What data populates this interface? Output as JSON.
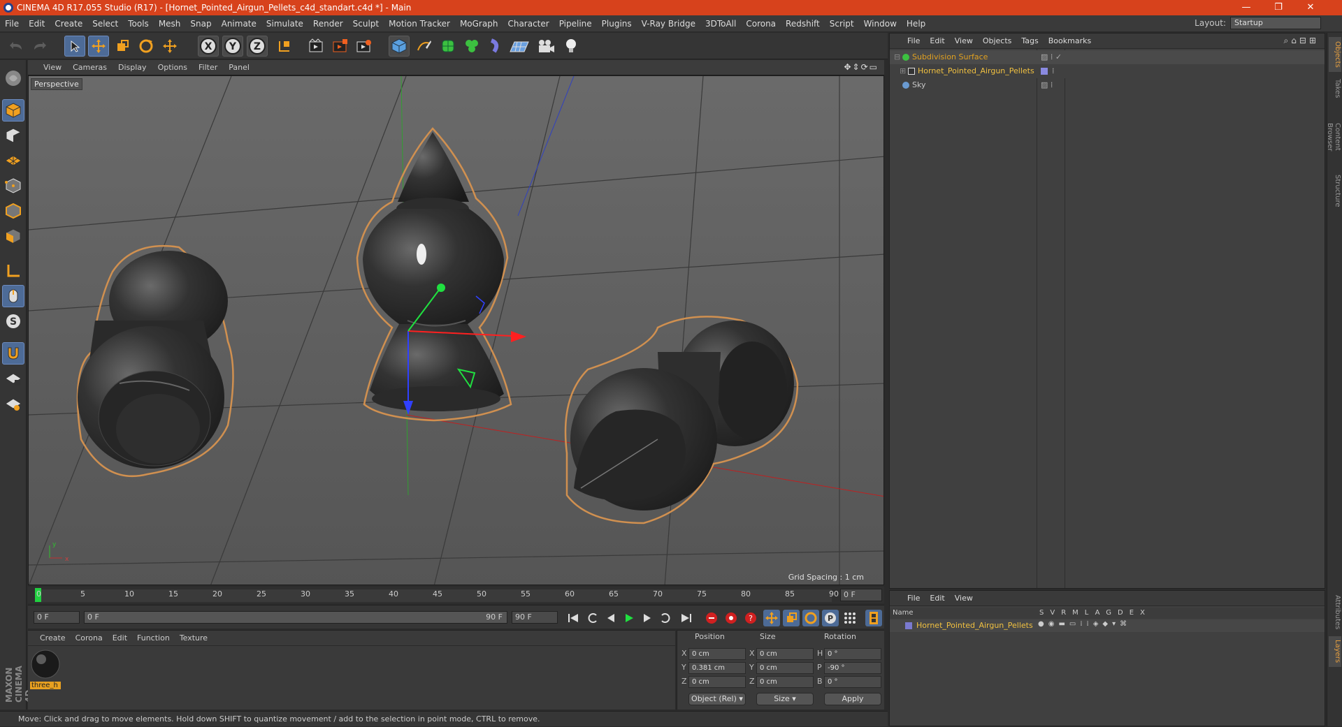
{
  "window": {
    "title": "CINEMA 4D R17.055 Studio (R17) - [Hornet_Pointed_Airgun_Pellets_c4d_standart.c4d *] - Main",
    "minimize": "—",
    "maximize": "❐",
    "close": "✕"
  },
  "menubar": {
    "items": [
      "File",
      "Edit",
      "Create",
      "Select",
      "Tools",
      "Mesh",
      "Snap",
      "Animate",
      "Simulate",
      "Render",
      "Sculpt",
      "Motion Tracker",
      "MoGraph",
      "Character",
      "Pipeline",
      "Plugins",
      "V-Ray Bridge",
      "3DToAll",
      "Corona",
      "Redshift",
      "Script",
      "Window",
      "Help"
    ],
    "layout_label": "Layout:",
    "layout_value": "Startup"
  },
  "toolbar": {
    "axis_x": "X",
    "axis_y": "Y",
    "axis_z": "Z"
  },
  "viewport": {
    "menu": [
      "View",
      "Cameras",
      "Display",
      "Options",
      "Filter",
      "Panel"
    ],
    "camera_label": "Perspective",
    "grid_spacing": "Grid Spacing : 1 cm",
    "axis_x": "x",
    "axis_y": "y"
  },
  "timeline": {
    "ticks": [
      "0",
      "5",
      "10",
      "15",
      "20",
      "25",
      "30",
      "35",
      "40",
      "45",
      "50",
      "55",
      "60",
      "65",
      "70",
      "75",
      "80",
      "85",
      "90"
    ],
    "current_frame": "0 F",
    "end_field": "0 F",
    "start_field": "0 F",
    "range_start": "0 F",
    "range_end": "90 F",
    "max_field": "90 F"
  },
  "material_panel": {
    "menu": [
      "Create",
      "Corona",
      "Edit",
      "Function",
      "Texture"
    ],
    "material_name": "three_h"
  },
  "coords": {
    "headers": {
      "position": "Position",
      "size": "Size",
      "rotation": "Rotation"
    },
    "rows": [
      {
        "pl": "X",
        "pv": "0 cm",
        "sl": "X",
        "sv": "0 cm",
        "rl": "H",
        "rv": "0 °"
      },
      {
        "pl": "Y",
        "pv": "0.381 cm",
        "sl": "Y",
        "sv": "0 cm",
        "rl": "P",
        "rv": "-90 °"
      },
      {
        "pl": "Z",
        "pv": "0 cm",
        "sl": "Z",
        "sv": "0 cm",
        "rl": "B",
        "rv": "0 °"
      }
    ],
    "mode_dropdown": "Object (Rel)",
    "size_dropdown": "Size",
    "apply": "Apply"
  },
  "statusbar": {
    "text": "Move: Click and drag to move elements. Hold down SHIFT to quantize movement / add to the selection in point mode, CTRL to remove."
  },
  "object_manager": {
    "menu": [
      "File",
      "Edit",
      "View",
      "Objects",
      "Tags",
      "Bookmarks"
    ],
    "objects": [
      {
        "name": "Subdivision Surface",
        "color": "#e0a020"
      },
      {
        "name": "Hornet_Pointed_Airgun_Pellets",
        "color": "#f0c040"
      },
      {
        "name": "Sky",
        "color": "#c8c8c8"
      }
    ]
  },
  "layer_manager": {
    "menu": [
      "File",
      "Edit",
      "View"
    ],
    "col_name": "Name",
    "cols": [
      "S",
      "V",
      "R",
      "M",
      "L",
      "A",
      "G",
      "D",
      "E",
      "X"
    ],
    "layer_name": "Hornet_Pointed_Airgun_Pellets",
    "layer_color": "#7a7ad0"
  },
  "right_tabs": [
    "Objects",
    "Takes",
    "Content Browser",
    "Structure",
    "Attributes",
    "Layers"
  ],
  "brand": "MAXON CINEMA 4D"
}
